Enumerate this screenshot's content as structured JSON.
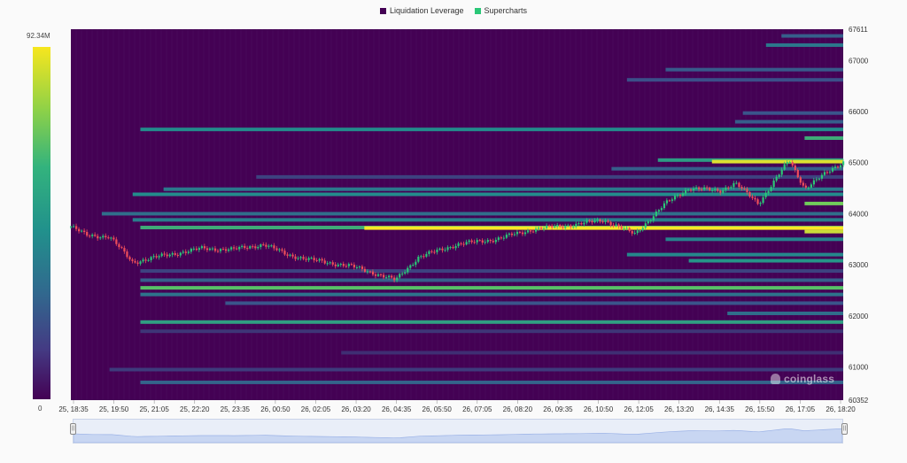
{
  "legend": [
    {
      "label": "Liquidation Leverage",
      "color": "#440154"
    },
    {
      "label": "Supercharts",
      "color": "#2ac777"
    }
  ],
  "colorbar": {
    "max_label": "92.34M",
    "min_label": "0"
  },
  "watermark": "coinglass",
  "chart_data": {
    "type": "heatmap",
    "title": "",
    "y_axis": {
      "side": "right",
      "range": [
        60352,
        67611
      ],
      "ticks": [
        "67611",
        "67000",
        "66000",
        "65000",
        "64000",
        "63000",
        "62000",
        "61000",
        "60352"
      ]
    },
    "x_axis": {
      "ticks": [
        "25, 18:35",
        "25, 19:50",
        "25, 21:05",
        "25, 22:20",
        "25, 23:35",
        "26, 00:50",
        "26, 02:05",
        "26, 03:20",
        "26, 04:35",
        "26, 05:50",
        "26, 07:05",
        "26, 08:20",
        "26, 09:35",
        "26, 10:50",
        "26, 12:05",
        "26, 13:20",
        "26, 14:35",
        "26, 15:50",
        "26, 17:05",
        "26, 18:20"
      ]
    },
    "heat_scale": {
      "min": 0,
      "max": "92.34M",
      "colormap": "viridis"
    },
    "liquidation_bands": [
      {
        "price": 67480,
        "start": 0.92,
        "intensity": 0.3
      },
      {
        "price": 67300,
        "start": 0.9,
        "intensity": 0.4
      },
      {
        "price": 66820,
        "start": 0.77,
        "intensity": 0.28
      },
      {
        "price": 66620,
        "start": 0.72,
        "intensity": 0.24
      },
      {
        "price": 65970,
        "start": 0.87,
        "intensity": 0.26
      },
      {
        "price": 65800,
        "start": 0.86,
        "intensity": 0.3
      },
      {
        "price": 65650,
        "start": 0.09,
        "intensity": 0.48
      },
      {
        "price": 65480,
        "start": 0.95,
        "intensity": 0.62
      },
      {
        "price": 65050,
        "start": 0.76,
        "intensity": 0.55
      },
      {
        "price": 65020,
        "start": 0.83,
        "intensity": 0.95
      },
      {
        "price": 64880,
        "start": 0.7,
        "intensity": 0.3
      },
      {
        "price": 64720,
        "start": 0.24,
        "intensity": 0.2
      },
      {
        "price": 64480,
        "start": 0.12,
        "intensity": 0.4
      },
      {
        "price": 64380,
        "start": 0.08,
        "intensity": 0.48
      },
      {
        "price": 64200,
        "start": 0.95,
        "intensity": 0.78
      },
      {
        "price": 64000,
        "start": 0.04,
        "intensity": 0.36
      },
      {
        "price": 63880,
        "start": 0.08,
        "intensity": 0.42
      },
      {
        "price": 63730,
        "start": 0.09,
        "intensity": 0.62
      },
      {
        "price": 63720,
        "start": 0.38,
        "intensity": 1.0
      },
      {
        "price": 63650,
        "start": 0.95,
        "intensity": 0.92
      },
      {
        "price": 63500,
        "start": 0.77,
        "intensity": 0.44
      },
      {
        "price": 63200,
        "start": 0.72,
        "intensity": 0.46
      },
      {
        "price": 63080,
        "start": 0.8,
        "intensity": 0.52
      },
      {
        "price": 62880,
        "start": 0.09,
        "intensity": 0.2
      },
      {
        "price": 62700,
        "start": 0.09,
        "intensity": 0.3
      },
      {
        "price": 62550,
        "start": 0.09,
        "intensity": 0.72
      },
      {
        "price": 62420,
        "start": 0.09,
        "intensity": 0.38
      },
      {
        "price": 62250,
        "start": 0.2,
        "intensity": 0.26
      },
      {
        "price": 62050,
        "start": 0.85,
        "intensity": 0.36
      },
      {
        "price": 61880,
        "start": 0.09,
        "intensity": 0.56
      },
      {
        "price": 61700,
        "start": 0.09,
        "intensity": 0.16
      },
      {
        "price": 61280,
        "start": 0.35,
        "intensity": 0.14
      },
      {
        "price": 60950,
        "start": 0.05,
        "intensity": 0.18
      },
      {
        "price": 60700,
        "start": 0.09,
        "intensity": 0.32
      }
    ],
    "price_series": {
      "name": "Supercharts",
      "start": 63750,
      "keypoints": [
        [
          0.0,
          63750
        ],
        [
          0.02,
          63580
        ],
        [
          0.05,
          63550
        ],
        [
          0.08,
          63050
        ],
        [
          0.12,
          63180
        ],
        [
          0.17,
          63320
        ],
        [
          0.21,
          63300
        ],
        [
          0.25,
          63400
        ],
        [
          0.28,
          63200
        ],
        [
          0.31,
          63100
        ],
        [
          0.36,
          62980
        ],
        [
          0.38,
          62900
        ],
        [
          0.42,
          62700
        ],
        [
          0.45,
          63150
        ],
        [
          0.5,
          63400
        ],
        [
          0.55,
          63500
        ],
        [
          0.6,
          63700
        ],
        [
          0.65,
          63780
        ],
        [
          0.69,
          63880
        ],
        [
          0.73,
          63600
        ],
        [
          0.77,
          64200
        ],
        [
          0.8,
          64500
        ],
        [
          0.84,
          64450
        ],
        [
          0.86,
          64600
        ],
        [
          0.89,
          64200
        ],
        [
          0.93,
          65050
        ],
        [
          0.95,
          64500
        ],
        [
          1.0,
          65020
        ]
      ]
    }
  }
}
